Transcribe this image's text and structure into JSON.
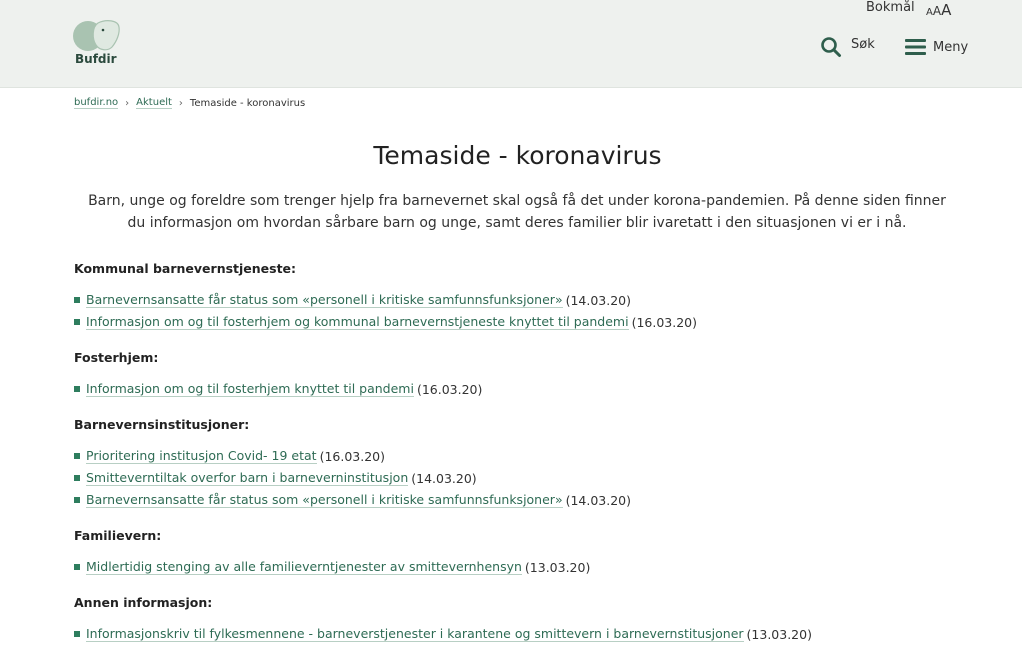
{
  "header": {
    "logo_text": "Bufdir",
    "language": "Bokmål",
    "text_size": {
      "small": "A",
      "medium": "A",
      "large": "A"
    },
    "search_label": "Søk",
    "menu_label": "Meny"
  },
  "breadcrumb": [
    {
      "label": "bufdir.no"
    },
    {
      "label": "Aktuelt"
    },
    {
      "label": "Temaside - koronavirus"
    }
  ],
  "page": {
    "title": "Temaside - koronavirus",
    "lead": "Barn, unge og foreldre som trenger hjelp fra barnevernet skal også få det under korona-pandemien. På denne siden finner du informasjon om hvordan sårbare barn og unge, samt deres familier blir ivaretatt i den situasjonen vi er i nå."
  },
  "sections": [
    {
      "heading": "Kommunal barnevernstjeneste:",
      "items": [
        {
          "link": "Barnevernsansatte får status som «personell i kritiske samfunnsfunksjoner»",
          "date": "(14.03.20)"
        },
        {
          "link": "Informasjon om og til fosterhjem og kommunal barnevernstjeneste knyttet til pandemi",
          "date": "(16.03.20)"
        }
      ]
    },
    {
      "heading": "Fosterhjem:",
      "items": [
        {
          "link": "Informasjon om og til fosterhjem knyttet til pandemi",
          "date": "(16.03.20)"
        }
      ]
    },
    {
      "heading": "Barnevernsinstitusjoner:",
      "items": [
        {
          "link": "Prioritering institusjon Covid- 19 etat",
          "date": "(16.03.20)"
        },
        {
          "link": "Smitteverntiltak overfor barn i barneverninstitusjon",
          "date": "(14.03.20)"
        },
        {
          "link": "Barnevernsansatte får status som «personell i kritiske samfunnsfunksjoner»",
          "date": "(14.03.20)"
        }
      ]
    },
    {
      "heading": "Familievern:",
      "items": [
        {
          "link": "Midlertidig stenging av alle familieverntjenester av smittevernhensyn",
          "date": "(13.03.20)"
        }
      ]
    },
    {
      "heading": "Annen informasjon:",
      "items": [
        {
          "link": "Informasjonskriv til fylkesmennene - barneverstjenester i karantene og smittevern i barnevernstitusjoner",
          "date": "(13.03.20)"
        }
      ]
    }
  ]
}
